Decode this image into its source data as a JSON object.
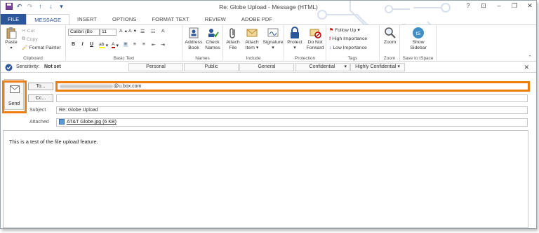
{
  "window": {
    "title": "Re: Globe Upload - Message (HTML)"
  },
  "tabs": [
    "FILE",
    "MESSAGE",
    "INSERT",
    "OPTIONS",
    "FORMAT TEXT",
    "REVIEW",
    "ADOBE PDF"
  ],
  "ribbon": {
    "clipboard": {
      "paste": "Paste",
      "cut": "Cut",
      "copy": "Copy",
      "format_painter": "Format Painter",
      "label": "Clipboard"
    },
    "basic_text": {
      "font": "Calibri (Bo",
      "size": "11",
      "label": "Basic Text"
    },
    "names": {
      "address_book": "Address Book",
      "check_names": "Check Names",
      "label": "Names"
    },
    "include": {
      "attach_file": "Attach File",
      "attach_item": "Attach Item",
      "signature": "Signature",
      "label": "Include"
    },
    "protection": {
      "protect": "Protect",
      "do_not_forward": "Do Not Forward",
      "label": "Protection"
    },
    "tags": {
      "follow_up": "Follow Up",
      "high_importance": "High Importance",
      "low_importance": "Low Importance",
      "label": "Tags"
    },
    "zoom": {
      "zoom": "Zoom",
      "label": "Zoom"
    },
    "tspace": {
      "show_sidebar": "Show Sidebar",
      "label": "Save to tSpace"
    }
  },
  "sensitivity": {
    "label": "Sensitivity:",
    "value": "Not set",
    "options": [
      "Personal",
      "Public",
      "General",
      "Confidential",
      "Highly Confidential"
    ]
  },
  "compose": {
    "send_label": "Send",
    "to_button": "To...",
    "cc_button": "Cc...",
    "to_value": "@u.box.com",
    "subject_label": "Subject",
    "subject_value": "Re: Globe Upload",
    "attached_label": "Attached",
    "attachment_name": "AT&T Globe.jpg (6 KB)"
  },
  "body_text": "This is a test of the file upload feature.",
  "colors": {
    "accent": "#2b579a",
    "highlight": "#f07c10"
  }
}
